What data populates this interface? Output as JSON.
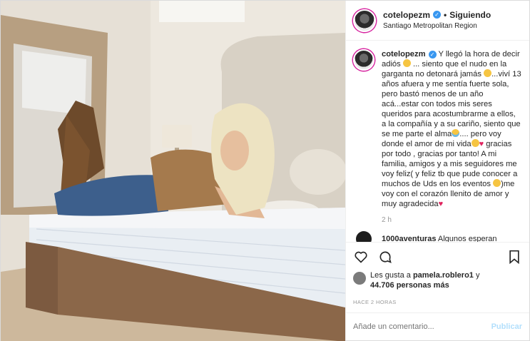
{
  "post": {
    "username": "cotelopezm",
    "follow_sep": "•",
    "follow_label": "Siguiendo",
    "location": "Santiago Metropolitan Region",
    "caption": {
      "p1": "Y llegó la hora de decir adiós",
      "p2": "... siento que el nudo en la garganta no detonará jamás",
      "p3": "...viví 13 años afuera y me sentía fuerte sola, pero bastó menos de un año acá...estar con todos mis seres queridos para acostumbrarme a ellos, a la compañía y a su cariño, siento que se me parte el alma",
      "p4": ".... pero voy donde el amor de mi vida",
      "p5": "gracias por todo , gracias por tanto! A mi familia, amigos y a mis seguidores me voy feliz( y feliz tb que pude conocer a muchos de Uds en los eventos ",
      "p6": ")me voy con el corazón llenito de amor y muy agradecida"
    },
    "caption_time": "2 h",
    "comment": {
      "user": "1000aventuras",
      "text": "Algunos esperan"
    },
    "likes_prefix": "Les gusta a",
    "likes_user": "pamela.roblero1",
    "likes_and": "y",
    "likes_count": "44.706 personas más",
    "timestamp": "HACE 2 HORAS",
    "comment_placeholder": "Añade un comentario...",
    "publish_label": "Publicar"
  },
  "icons": {
    "verified": "verified-badge-icon",
    "like": "heart-icon",
    "comment": "comment-bubble-icon",
    "save": "bookmark-icon"
  },
  "colors": {
    "verified": "#3897f0",
    "publish_disabled": "#b2dffc",
    "heart_emoji": "#e0245e"
  }
}
